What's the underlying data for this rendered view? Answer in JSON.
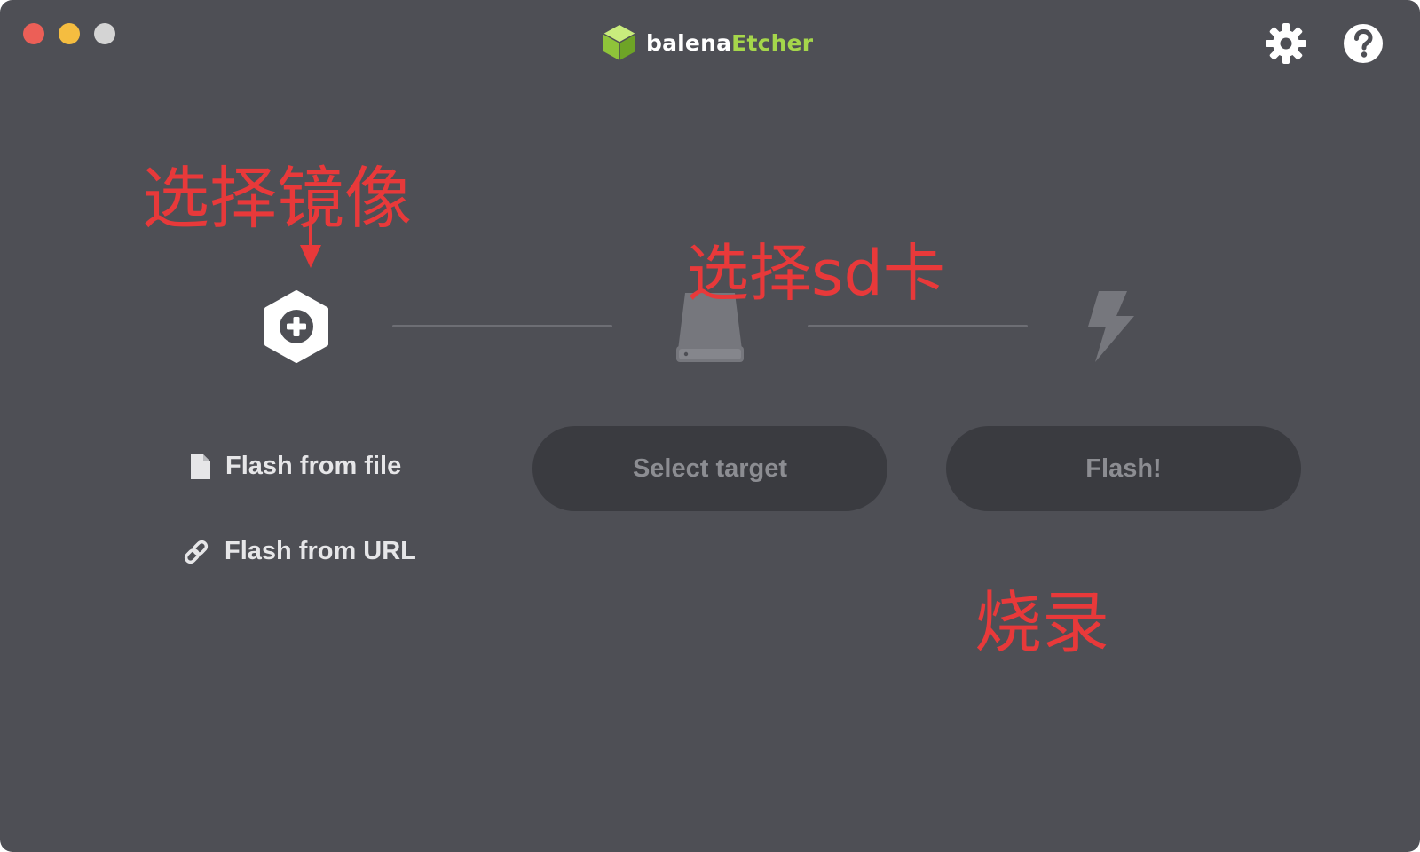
{
  "window": {
    "controls": [
      "close",
      "minimize",
      "zoom"
    ]
  },
  "header": {
    "logo_word_1": "balena",
    "logo_word_2": "Etcher",
    "logo_icon": "cube-icon",
    "settings_icon": "gear-icon",
    "help_icon": "question-mark-icon"
  },
  "steps": {
    "source": {
      "icon": "plus-hexagon-icon",
      "flash_from_file_label": "Flash from file",
      "flash_from_file_icon": "file-icon",
      "flash_from_url_label": "Flash from URL",
      "flash_from_url_icon": "link-icon"
    },
    "target": {
      "icon": "drive-icon",
      "button_label": "Select target"
    },
    "flash": {
      "icon": "lightning-icon",
      "button_label": "Flash!"
    }
  },
  "annotations": {
    "select_image": "选择镜像",
    "select_sd_card": "选择sd卡",
    "burn": "烧录"
  },
  "colors": {
    "background": "#4e4f55",
    "button_background": "#3a3b40",
    "button_text_disabled": "#8c8d92",
    "brand_green": "#a5d64b",
    "annotation_red": "#e8393a"
  }
}
